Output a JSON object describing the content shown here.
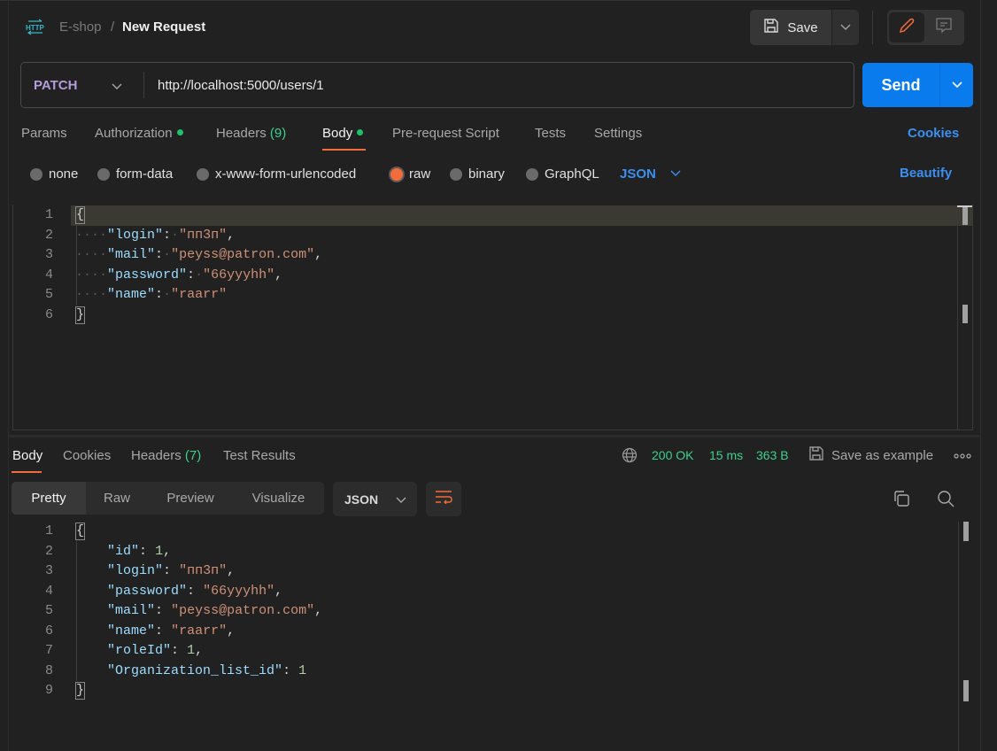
{
  "header": {
    "icon": "http-request-icon",
    "breadcrumb_parent": "E-shop",
    "breadcrumb_separator": "/",
    "title": "New Request",
    "save_label": "Save"
  },
  "request": {
    "method": "PATCH",
    "url": "http://localhost:5000/users/1",
    "send_label": "Send"
  },
  "request_tabs": [
    {
      "label": "Params"
    },
    {
      "label": "Authorization",
      "dot": true
    },
    {
      "label": "Headers",
      "count": "(9)"
    },
    {
      "label": "Body",
      "dot": true,
      "active": true
    },
    {
      "label": "Pre-request Script"
    },
    {
      "label": "Tests"
    },
    {
      "label": "Settings"
    }
  ],
  "cookies_link": "Cookies",
  "body_types": [
    {
      "label": "none",
      "selected": false
    },
    {
      "label": "form-data",
      "selected": false
    },
    {
      "label": "x-www-form-urlencoded",
      "selected": false
    },
    {
      "label": "raw",
      "selected": true
    },
    {
      "label": "binary",
      "selected": false
    },
    {
      "label": "GraphQL",
      "selected": false
    }
  ],
  "raw_language": "JSON",
  "beautify_label": "Beautify",
  "request_body": {
    "line_numbers": [
      "1",
      "2",
      "3",
      "4",
      "5",
      "6"
    ],
    "lines": [
      {
        "open": "{"
      },
      {
        "key": "\"login\"",
        "value": "\"пп3п\"",
        "type": "string",
        "comma": true
      },
      {
        "key": "\"mail\"",
        "value": "\"peyss@patron.com\"",
        "type": "string",
        "comma": true
      },
      {
        "key": "\"password\"",
        "value": "\"66yyyhh\"",
        "type": "string",
        "comma": true
      },
      {
        "key": "\"name\"",
        "value": "\"raarr\"",
        "type": "string",
        "comma": false
      },
      {
        "close": "}"
      }
    ]
  },
  "response_tabs": [
    {
      "label": "Body",
      "active": true
    },
    {
      "label": "Cookies"
    },
    {
      "label": "Headers",
      "count": "(7)"
    },
    {
      "label": "Test Results"
    }
  ],
  "response_status": {
    "status": "200 OK",
    "time": "15 ms",
    "size": "363 B",
    "save_example_label": "Save as example",
    "colors": {
      "success": "#3ecf8e",
      "accent": "#f26b3a",
      "primary": "#097bed"
    }
  },
  "response_views": [
    {
      "label": "Pretty",
      "active": true
    },
    {
      "label": "Raw"
    },
    {
      "label": "Preview"
    },
    {
      "label": "Visualize"
    }
  ],
  "response_format": "JSON",
  "response_body": {
    "line_numbers": [
      "1",
      "2",
      "3",
      "4",
      "5",
      "6",
      "7",
      "8",
      "9"
    ],
    "lines": [
      {
        "open": "{"
      },
      {
        "key": "\"id\"",
        "value": "1",
        "type": "number",
        "comma": true
      },
      {
        "key": "\"login\"",
        "value": "\"пп3п\"",
        "type": "string",
        "comma": true
      },
      {
        "key": "\"password\"",
        "value": "\"66yyyhh\"",
        "type": "string",
        "comma": true
      },
      {
        "key": "\"mail\"",
        "value": "\"peyss@patron.com\"",
        "type": "string",
        "comma": true
      },
      {
        "key": "\"name\"",
        "value": "\"raarr\"",
        "type": "string",
        "comma": true
      },
      {
        "key": "\"roleId\"",
        "value": "1",
        "type": "number",
        "comma": true
      },
      {
        "key": "\"Organization_list_id\"",
        "value": "1",
        "type": "number",
        "comma": false
      },
      {
        "close": "}"
      }
    ]
  }
}
